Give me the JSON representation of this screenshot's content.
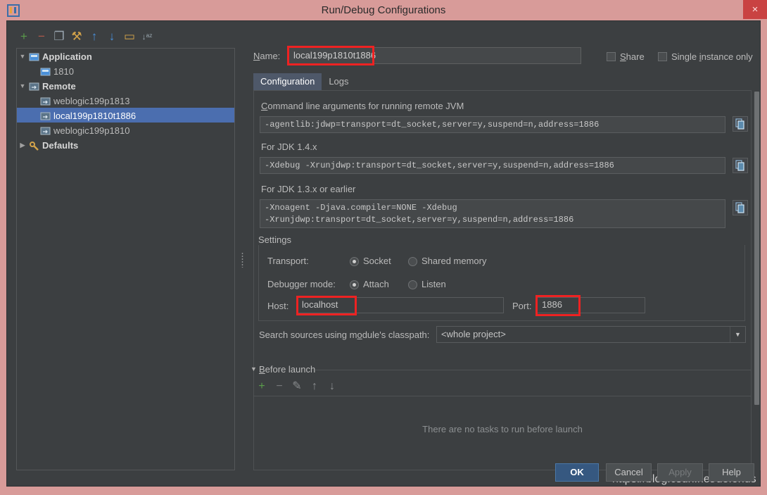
{
  "window": {
    "title": "Run/Debug Configurations",
    "logo_icon": "intellij-idea-logo",
    "close_icon": "close-icon",
    "close_label": "×",
    "titlebar_color": "#d89b99",
    "close_color": "#c94242",
    "accent_color": "#4b6eaf",
    "annotation_color": "#ee2222"
  },
  "tree_toolbar": {
    "buttons": [
      {
        "name": "add-configuration-button",
        "icon": "plus-icon",
        "glyph": "+",
        "color": "#5a9c4a"
      },
      {
        "name": "remove-configuration-button",
        "icon": "minus-icon",
        "glyph": "−",
        "color": "#b05a4a"
      },
      {
        "name": "copy-configuration-button",
        "icon": "copy-icon",
        "glyph": "❐",
        "color": "#9aa7b0"
      },
      {
        "name": "edit-defaults-button",
        "icon": "wrench-icon",
        "glyph": "⚒",
        "color": "#d3a34a"
      },
      {
        "name": "move-up-button",
        "icon": "arrow-up-icon",
        "glyph": "↑",
        "color": "#4a90d9"
      },
      {
        "name": "move-down-button",
        "icon": "arrow-down-icon",
        "glyph": "↓",
        "color": "#4a90d9"
      },
      {
        "name": "create-folder-button",
        "icon": "folder-icon",
        "glyph": "▭",
        "color": "#d3a34a"
      },
      {
        "name": "sort-configurations-button",
        "icon": "sort-az-icon",
        "glyph": "↓ᵃᶻ",
        "color": "#9aa7b0"
      }
    ]
  },
  "tree": {
    "rows": [
      {
        "name": "tree-group-application",
        "label": "Application",
        "level": 0,
        "twisty": "▼",
        "expanded": true,
        "group": true,
        "icon": "application-icon",
        "selected": false
      },
      {
        "name": "tree-item-1810",
        "label": "1810",
        "level": 1,
        "twisty": "",
        "group": false,
        "icon": "application-icon",
        "selected": false
      },
      {
        "name": "tree-group-remote",
        "label": "Remote",
        "level": 0,
        "twisty": "▼",
        "expanded": true,
        "group": true,
        "icon": "remote-icon",
        "selected": false
      },
      {
        "name": "tree-item-weblogic199p1813",
        "label": "weblogic199p1813",
        "level": 1,
        "twisty": "",
        "group": false,
        "icon": "remote-icon",
        "selected": false
      },
      {
        "name": "tree-item-local199p1810t1886",
        "label": "local199p1810t1886",
        "level": 1,
        "twisty": "",
        "group": false,
        "icon": "remote-icon",
        "selected": true
      },
      {
        "name": "tree-item-weblogic199p1810",
        "label": "weblogic199p1810",
        "level": 1,
        "twisty": "",
        "group": false,
        "icon": "remote-icon",
        "selected": false
      },
      {
        "name": "tree-group-defaults",
        "label": "Defaults",
        "level": 0,
        "twisty": "▶",
        "expanded": false,
        "group": true,
        "icon": "wrench-icon",
        "selected": false
      }
    ]
  },
  "header": {
    "name_label": "Name:",
    "name_mnemonic": "N",
    "name_value": "local199p1810t1886",
    "name_placeholder": "",
    "share_label": "Share",
    "share_mnemonic": "S",
    "share_checked": false,
    "single_instance_label": "Single instance only",
    "single_instance_prefix": "Single ",
    "single_instance_mnemonic": "i",
    "single_instance_suffix": "nstance only",
    "single_instance_checked": false
  },
  "tabs": [
    {
      "name": "tab-configuration",
      "label": "Configuration",
      "active": true
    },
    {
      "name": "tab-logs",
      "label": "Logs",
      "active": false
    }
  ],
  "configuration": {
    "cmdline_label_prefix": "",
    "cmdline_mnemonic": "C",
    "cmdline_label": "ommand line arguments for running remote JVM",
    "cmdline_value": "-agentlib:jdwp=transport=dt_socket,server=y,suspend=n,address=1886",
    "jdk14_label": "For JDK 1.4.x",
    "jdk14_value": "-Xdebug -Xrunjdwp:transport=dt_socket,server=y,suspend=n,address=1886",
    "jdk13_label": "For JDK 1.3.x or earlier",
    "jdk13_value": "-Xnoagent -Djava.compiler=NONE -Xdebug\n-Xrunjdwp:transport=dt_socket,server=y,suspend=n,address=1886",
    "copy_icon": "copy-to-clipboard-icon",
    "settings_title": "Settings",
    "transport_label": "Transport:",
    "transport_options": [
      {
        "name": "radio-transport-socket",
        "label": "Socket",
        "selected": true
      },
      {
        "name": "radio-transport-shared-memory",
        "label": "Shared memory",
        "selected": false
      }
    ],
    "debugger_mode_label": "Debugger mode:",
    "debugger_mode_options": [
      {
        "name": "radio-debugger-attach",
        "label": "Attach",
        "selected": true
      },
      {
        "name": "radio-debugger-listen",
        "label": "Listen",
        "selected": false
      }
    ],
    "host_label": "Host:",
    "host_value": "localhost",
    "port_label": "Port:",
    "port_value": "1886",
    "classpath_label_pre": "Search sources using m",
    "classpath_mnemonic": "o",
    "classpath_label_post": "dule's classpath:",
    "classpath_value": "<whole project>",
    "classpath_arrow": "▼"
  },
  "before_launch": {
    "twisty": "▼",
    "title": "Before launch",
    "title_mnemonic": "B",
    "title_rest": "efore launch",
    "buttons": [
      {
        "name": "before-launch-add-button",
        "icon": "plus-icon",
        "glyph": "+",
        "color": "#5a9c4a"
      },
      {
        "name": "before-launch-remove-button",
        "icon": "minus-icon",
        "glyph": "−",
        "color": "#777a7c"
      },
      {
        "name": "before-launch-edit-button",
        "icon": "pencil-icon",
        "glyph": "✎",
        "color": "#8a8d8f"
      },
      {
        "name": "before-launch-move-up-button",
        "icon": "arrow-up-icon",
        "glyph": "↑",
        "color": "#8a8d8f"
      },
      {
        "name": "before-launch-move-down-button",
        "icon": "arrow-down-icon",
        "glyph": "↓",
        "color": "#8a8d8f"
      }
    ],
    "empty_text": "There are no tasks to run before launch"
  },
  "footer": {
    "buttons": [
      {
        "name": "ok-button",
        "label": "OK",
        "primary": true,
        "disabled": false
      },
      {
        "name": "cancel-button",
        "label": "Cancel",
        "primary": false,
        "disabled": false
      },
      {
        "name": "apply-button",
        "label": "Apply",
        "primary": false,
        "disabled": true
      },
      {
        "name": "help-button",
        "label": "Help",
        "primary": false,
        "disabled": false
      }
    ]
  },
  "watermark": "https://blog.csdn.net/defonds"
}
